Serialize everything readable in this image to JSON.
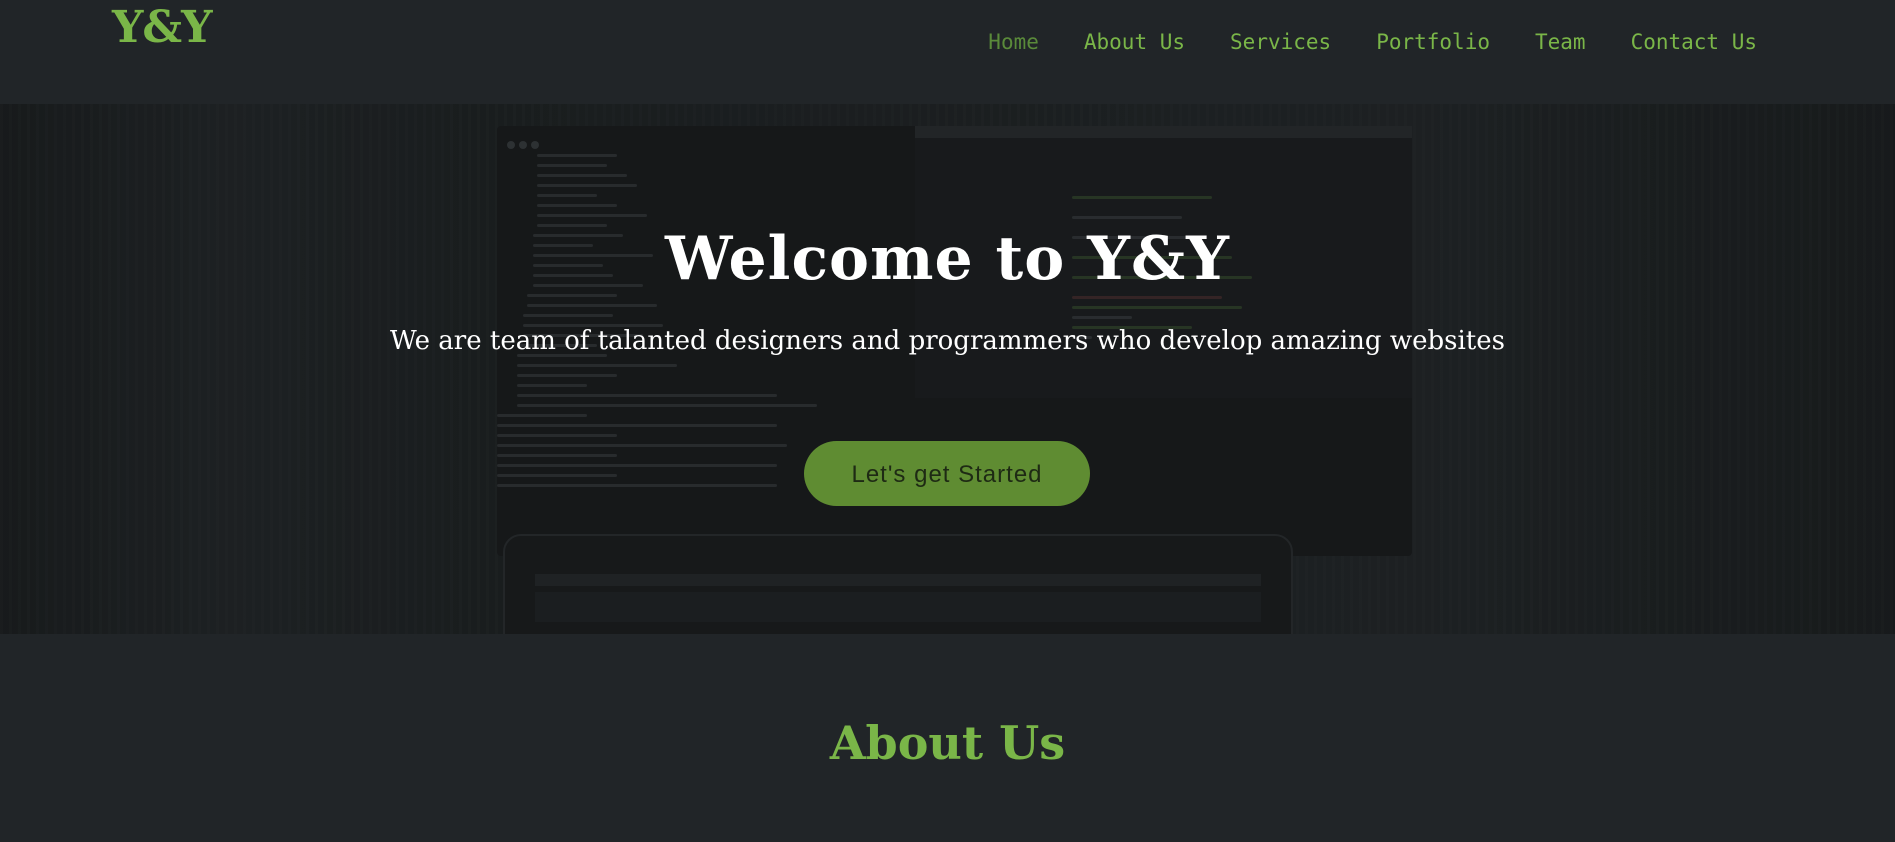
{
  "brand": {
    "logo_text": "Y&Y",
    "accent_color": "#7ab648",
    "background_color": "#212528"
  },
  "nav": {
    "items": [
      {
        "label": "Home",
        "active": true
      },
      {
        "label": "About Us",
        "active": false
      },
      {
        "label": "Services",
        "active": false
      },
      {
        "label": "Portfolio",
        "active": false
      },
      {
        "label": "Team",
        "active": false
      },
      {
        "label": "Contact Us",
        "active": false
      }
    ]
  },
  "hero": {
    "title": "Welcome to Y&Y",
    "subtitle": "We are team of talanted designers and programmers who develop amazing websites",
    "cta_label": "Let's get Started",
    "cta_color": "#5f8c32",
    "background_image": "blurred-code-screen-image"
  },
  "about": {
    "title": "About Us"
  }
}
